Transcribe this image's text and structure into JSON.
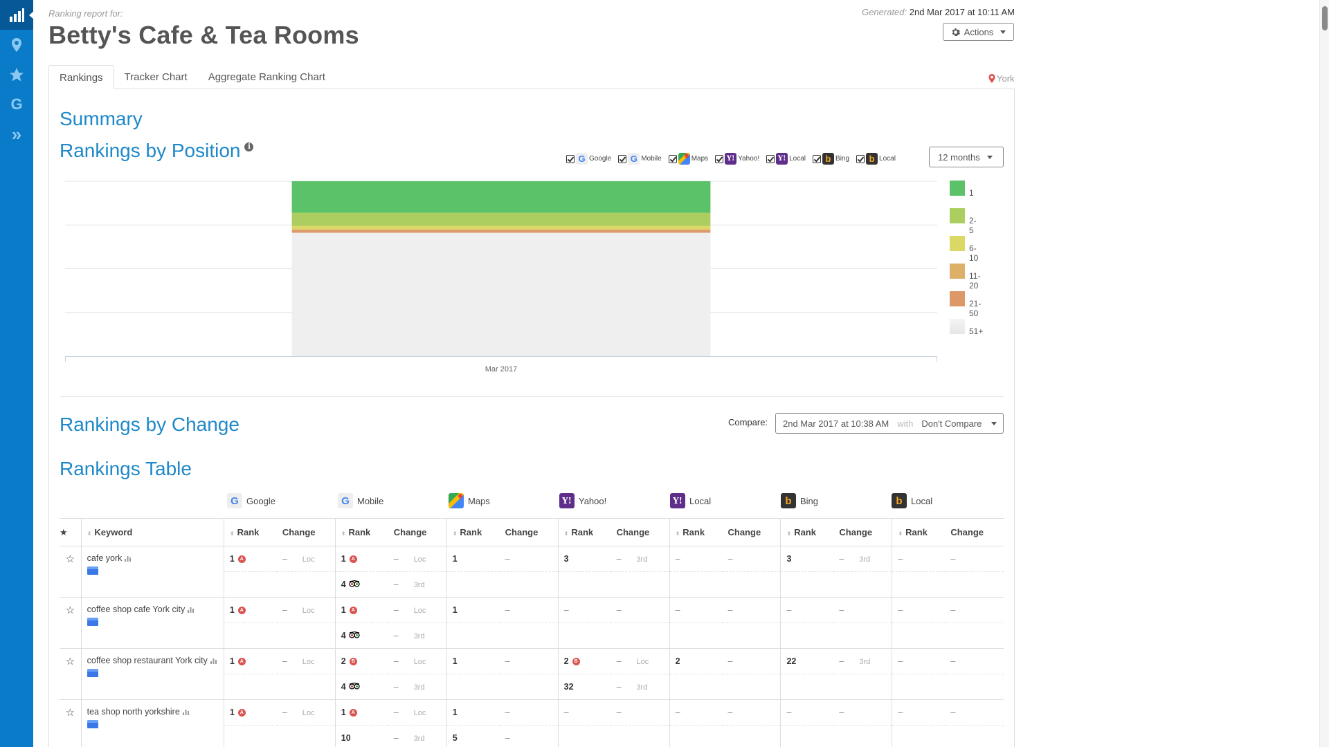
{
  "sidebar": {
    "items": [
      {
        "name": "rankings",
        "icon": "bar-chart-icon",
        "active": true
      },
      {
        "name": "locations",
        "icon": "map-pin-icon",
        "active": false
      },
      {
        "name": "reviews",
        "icon": "star-icon",
        "active": false
      },
      {
        "name": "google",
        "icon": "google-icon",
        "glyph": "G",
        "active": false
      },
      {
        "name": "expand",
        "icon": "double-chevron-right-icon",
        "glyph": "»",
        "active": false
      }
    ]
  },
  "header": {
    "report_for": "Ranking report for:",
    "title": "Betty's Cafe & Tea Rooms",
    "generated_label": "Generated:",
    "generated_value": "2nd Mar 2017 at 10:11 AM",
    "actions_label": "Actions",
    "location": "York"
  },
  "tabs": [
    {
      "label": "Rankings",
      "active": true
    },
    {
      "label": "Tracker Chart",
      "active": false
    },
    {
      "label": "Aggregate Ranking Chart",
      "active": false
    }
  ],
  "summary": {
    "title": "Summary",
    "position_title": "Rankings by Position",
    "info_glyph": "i",
    "engine_filters": [
      {
        "label": "Google",
        "icon": "google",
        "checked": true
      },
      {
        "label": "Mobile",
        "icon": "google",
        "checked": true
      },
      {
        "label": "Maps",
        "icon": "maps",
        "checked": true
      },
      {
        "label": "Yahoo!",
        "icon": "yahoo",
        "checked": true
      },
      {
        "label": "Local",
        "icon": "yahoo",
        "checked": true
      },
      {
        "label": "Bing",
        "icon": "bing",
        "checked": true
      },
      {
        "label": "Local",
        "icon": "bing",
        "checked": true
      }
    ],
    "period_select": "12 months"
  },
  "chart_data": {
    "type": "bar",
    "stacked": true,
    "title": "Rankings by Position",
    "xlabel": "",
    "ylabel": "",
    "categories": [
      "Mar 2017"
    ],
    "ylim": [
      0,
      100
    ],
    "unit": "percent",
    "grid": true,
    "legend_position": "right",
    "series": [
      {
        "name": "1",
        "values": [
          18
        ],
        "color": "#5cc26a"
      },
      {
        "name": "2-5",
        "values": [
          7.5
        ],
        "color": "#acce60"
      },
      {
        "name": "6-10",
        "values": [
          2
        ],
        "color": "#dcd865"
      },
      {
        "name": "11-20",
        "values": [
          0.5
        ],
        "color": "#ddb068"
      },
      {
        "name": "21-50",
        "values": [
          1.5
        ],
        "color": "#dd9868"
      },
      {
        "name": "51+",
        "values": [
          70.5
        ],
        "color": "#efefef"
      }
    ]
  },
  "change": {
    "title": "Rankings by Change",
    "compare_label": "Compare:",
    "compare_date": "2nd Mar 2017 at 10:38 AM",
    "compare_with": "with",
    "compare_value": "Don't Compare"
  },
  "table": {
    "title": "Rankings Table",
    "engines": [
      {
        "label": "Google",
        "icon": "google"
      },
      {
        "label": "Mobile",
        "icon": "google"
      },
      {
        "label": "Maps",
        "icon": "maps"
      },
      {
        "label": "Yahoo!",
        "icon": "yahoo"
      },
      {
        "label": "Local",
        "icon": "yahoo"
      },
      {
        "label": "Bing",
        "icon": "bing"
      },
      {
        "label": "Local",
        "icon": "bing"
      }
    ],
    "headers": {
      "keyword": "Keyword",
      "rank": "Rank",
      "change": "Change"
    },
    "rows": [
      {
        "keyword": "cafe york",
        "lines": [
          [
            [
              "1",
              "A",
              "–",
              "Loc"
            ],
            [
              "1",
              "A",
              "–",
              "Loc"
            ],
            [
              "1",
              "",
              "–",
              ""
            ],
            [
              "3",
              "",
              "–",
              "3rd"
            ],
            [
              "–",
              "",
              "–",
              ""
            ],
            [
              "3",
              "",
              "–",
              "3rd"
            ],
            [
              "–",
              "",
              "–",
              ""
            ]
          ],
          [
            [
              "",
              "",
              "",
              ""
            ],
            [
              "4",
              "owl",
              "–",
              "3rd"
            ],
            [
              "",
              "",
              "",
              ""
            ],
            [
              "",
              "",
              "",
              ""
            ],
            [
              "",
              "",
              "",
              ""
            ],
            [
              "",
              "",
              "",
              ""
            ],
            [
              "",
              "",
              "",
              ""
            ]
          ]
        ]
      },
      {
        "keyword": "coffee shop cafe York city",
        "lines": [
          [
            [
              "1",
              "A",
              "–",
              "Loc"
            ],
            [
              "1",
              "A",
              "–",
              "Loc"
            ],
            [
              "1",
              "",
              "–",
              ""
            ],
            [
              "–",
              "",
              "–",
              ""
            ],
            [
              "–",
              "",
              "–",
              ""
            ],
            [
              "–",
              "",
              "–",
              ""
            ],
            [
              "–",
              "",
              "–",
              ""
            ]
          ],
          [
            [
              "",
              "",
              "",
              ""
            ],
            [
              "4",
              "owl",
              "–",
              "3rd"
            ],
            [
              "",
              "",
              "",
              ""
            ],
            [
              "",
              "",
              "",
              ""
            ],
            [
              "",
              "",
              "",
              ""
            ],
            [
              "",
              "",
              "",
              ""
            ],
            [
              "",
              "",
              "",
              ""
            ]
          ]
        ]
      },
      {
        "keyword": "coffee shop restaurant York city",
        "lines": [
          [
            [
              "1",
              "A",
              "–",
              "Loc"
            ],
            [
              "2",
              "B",
              "–",
              "Loc"
            ],
            [
              "1",
              "",
              "–",
              ""
            ],
            [
              "2",
              "B",
              "–",
              "Loc"
            ],
            [
              "2",
              "",
              "–",
              ""
            ],
            [
              "22",
              "",
              "–",
              "3rd"
            ],
            [
              "–",
              "",
              "–",
              ""
            ]
          ],
          [
            [
              "",
              "",
              "",
              ""
            ],
            [
              "4",
              "owl",
              "–",
              "3rd"
            ],
            [
              "",
              "",
              "",
              ""
            ],
            [
              "32",
              "",
              "–",
              "3rd"
            ],
            [
              "",
              "",
              "",
              ""
            ],
            [
              "",
              "",
              "",
              ""
            ],
            [
              "",
              "",
              "",
              ""
            ]
          ]
        ]
      },
      {
        "keyword": "tea shop north yorkshire",
        "lines": [
          [
            [
              "1",
              "A",
              "–",
              "Loc"
            ],
            [
              "1",
              "A",
              "–",
              "Loc"
            ],
            [
              "1",
              "",
              "–",
              ""
            ],
            [
              "–",
              "",
              "–",
              ""
            ],
            [
              "–",
              "",
              "–",
              ""
            ],
            [
              "–",
              "",
              "–",
              ""
            ],
            [
              "–",
              "",
              "–",
              ""
            ]
          ],
          [
            [
              "",
              "",
              "",
              ""
            ],
            [
              "10",
              "",
              "–",
              "3rd"
            ],
            [
              "5",
              "",
              "–",
              ""
            ],
            [
              "",
              "",
              "",
              ""
            ],
            [
              "",
              "",
              "",
              ""
            ],
            [
              "",
              "",
              "",
              ""
            ],
            [
              "",
              "",
              "",
              ""
            ]
          ]
        ]
      }
    ]
  }
}
